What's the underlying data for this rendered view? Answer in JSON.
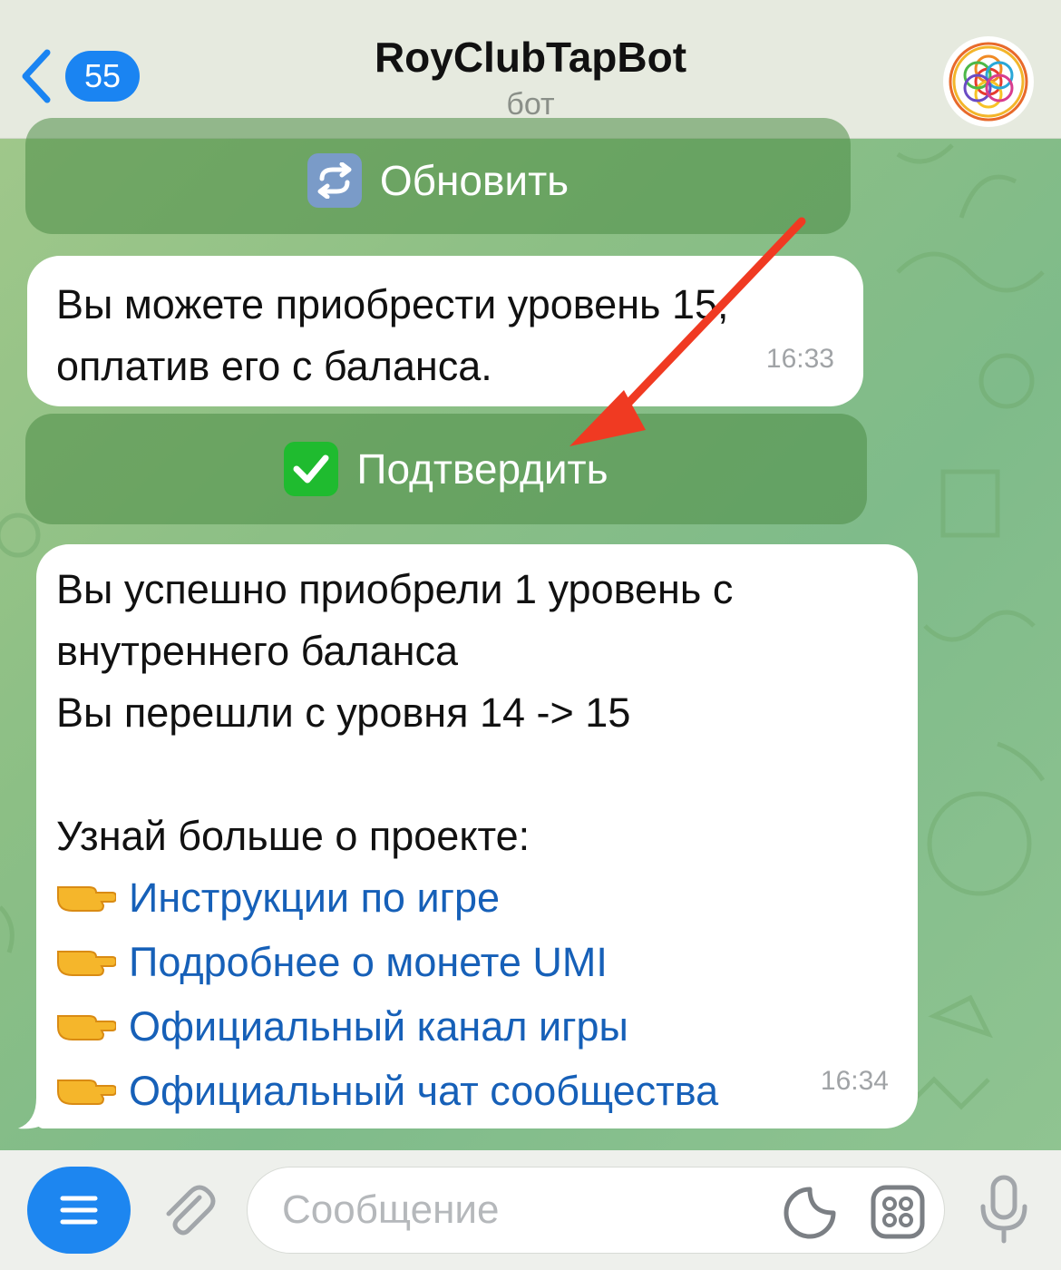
{
  "header": {
    "back_count": "55",
    "title": "RoyClubTapBot",
    "subtitle": "бот"
  },
  "keyboard": {
    "refresh_label": "Обновить",
    "confirm_label": "Подтвердить"
  },
  "messages": [
    {
      "lines": [
        "Вы можете приобрести уровень 15,",
        "оплатив его с баланса."
      ],
      "time": "16:33"
    },
    {
      "lines": [
        "Вы успешно приобрели 1 уровень с",
        "внутреннего баланса",
        "Вы перешли с уровня 14 -> 15",
        "",
        "Узнай больше о проекте:"
      ],
      "links": [
        "Инструкции по игре",
        "Подробнее о монете UMI",
        "Официальный канал игры",
        "Официальный чат сообщества"
      ],
      "time": "16:34"
    }
  ],
  "composer": {
    "placeholder": "Сообщение"
  },
  "colors": {
    "accent": "#1a84f2",
    "link": "#1660b8",
    "annotation_arrow": "#f03a22",
    "confirm_check": "#1fbb2f"
  },
  "icons": [
    "chevron-left-icon",
    "refresh-icon",
    "check-icon",
    "pointing-hand-icon",
    "menu-icon",
    "paperclip-icon",
    "sticker-icon",
    "keyboard-grid-icon",
    "microphone-icon"
  ]
}
